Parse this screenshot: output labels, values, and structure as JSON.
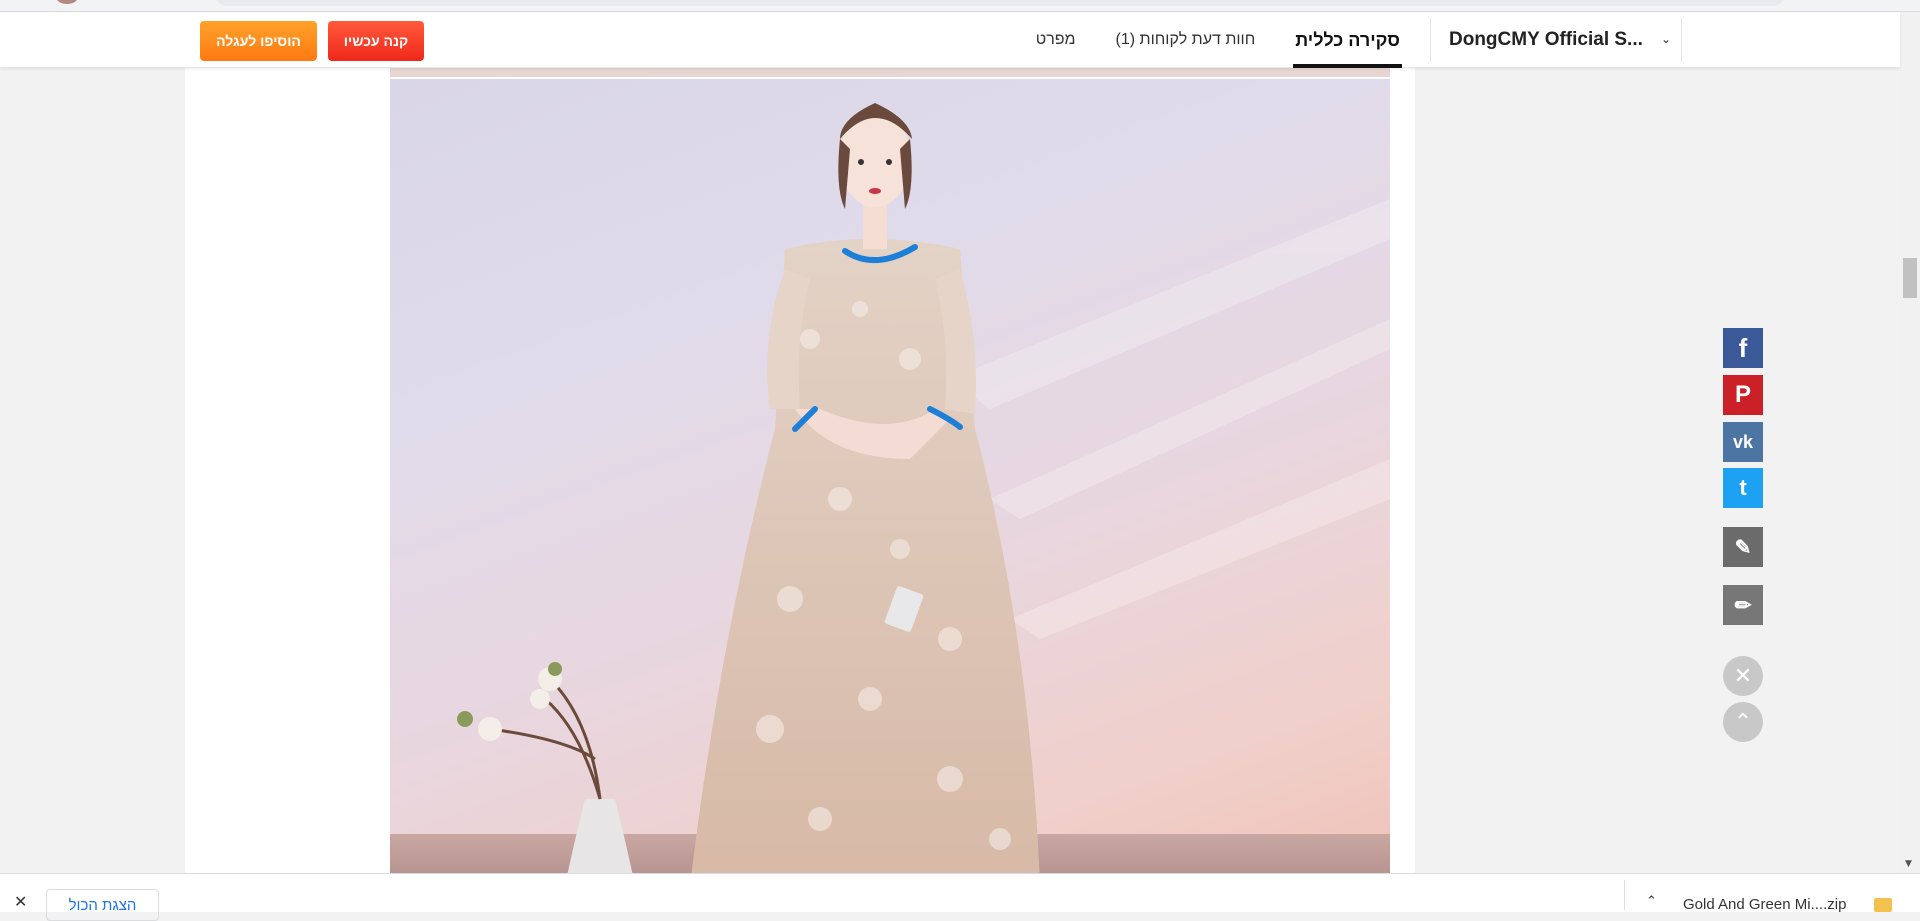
{
  "nav": {
    "store_name": "DongCMY Official S...",
    "tabs": [
      "סקירה כללית",
      "חוות דעת לקוחות (1)",
      "מפרט"
    ],
    "buy_now": "קנה עכשיו",
    "add_to_cart": "הוסיפו לעגלה"
  },
  "share": {
    "facebook": "f",
    "pinterest": "P",
    "vk": "vk",
    "twitter": "t",
    "icons": [
      "facebook-icon",
      "pinterest-icon",
      "vk-icon",
      "twitter-icon",
      "edit-icon",
      "pen-icon",
      "close-icon",
      "arrow-up-icon"
    ]
  },
  "download_bar": {
    "show_all": "הצגת הכול",
    "file_name": "Gold And Green Mi....zip"
  },
  "colors": {
    "buy_now": "#f0281a",
    "add_to_cart": "#ff7a12",
    "facebook": "#3b5998",
    "pinterest": "#cb2027",
    "vk": "#4c75a3",
    "twitter": "#1da1f2"
  }
}
